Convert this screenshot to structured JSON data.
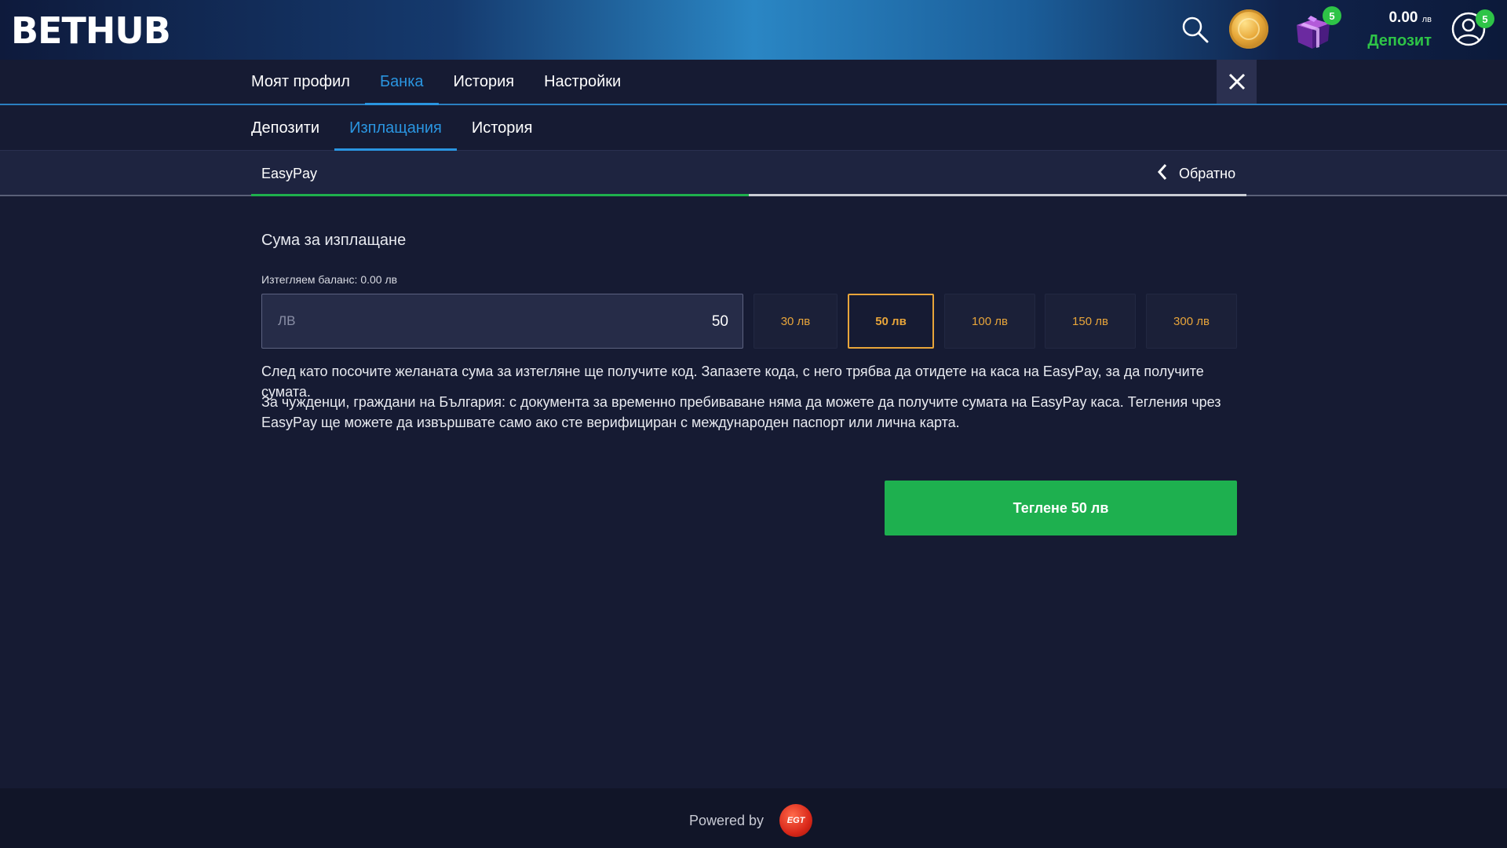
{
  "header": {
    "logo": "BETHUB",
    "gift_badge": "5",
    "balance_amount": "0.00",
    "balance_currency": "лв",
    "deposit_label": "Депозит",
    "avatar_badge": "5",
    "icons": [
      "search-icon",
      "coin-icon",
      "gift-icon",
      "user-icon"
    ]
  },
  "main_nav": {
    "tabs": [
      {
        "label": "Моят профил",
        "active": false
      },
      {
        "label": "Банка",
        "active": true
      },
      {
        "label": "История",
        "active": false
      },
      {
        "label": "Настройки",
        "active": false
      }
    ]
  },
  "sub_nav": {
    "tabs": [
      {
        "label": "Депозити",
        "active": false
      },
      {
        "label": "Изплащания",
        "active": true
      },
      {
        "label": "История",
        "active": false
      }
    ]
  },
  "method_bar": {
    "method": "EasyPay",
    "back_label": "Обратно",
    "progress_fraction": 0.5
  },
  "form": {
    "title": "Сума за изплащане",
    "withdrawable": "Изтегляем баланс: 0.00 лв",
    "currency_label": "ЛВ",
    "amount_value": "50",
    "presets": [
      {
        "label": "30 лв",
        "active": false
      },
      {
        "label": "50 лв",
        "active": true
      },
      {
        "label": "100 лв",
        "active": false
      },
      {
        "label": "150 лв",
        "active": false
      },
      {
        "label": "300 лв",
        "active": false
      }
    ],
    "info_1": "След като посочите желаната сума за изтегляне ще получите код. Запазете кода, с него трябва да отидете на каса на EasyPay, за да получите сумата.",
    "info_2": "За чужденци, граждани на България: с документа за временно пребиваване няма да можете да получите сумата на EasyPay каса. Тегления чрез EasyPay ще можете да извършвате само ако сте верифициран с международен паспорт или лична карта.",
    "submit_label": "Теглене 50 лв"
  },
  "footer": {
    "powered_by": "Powered by",
    "provider_logo": "EGT"
  },
  "colors": {
    "accent_blue": "#2a95e0",
    "accent_green": "#1eb04f",
    "accent_orange": "#e8a53a",
    "background": "#161b33"
  }
}
